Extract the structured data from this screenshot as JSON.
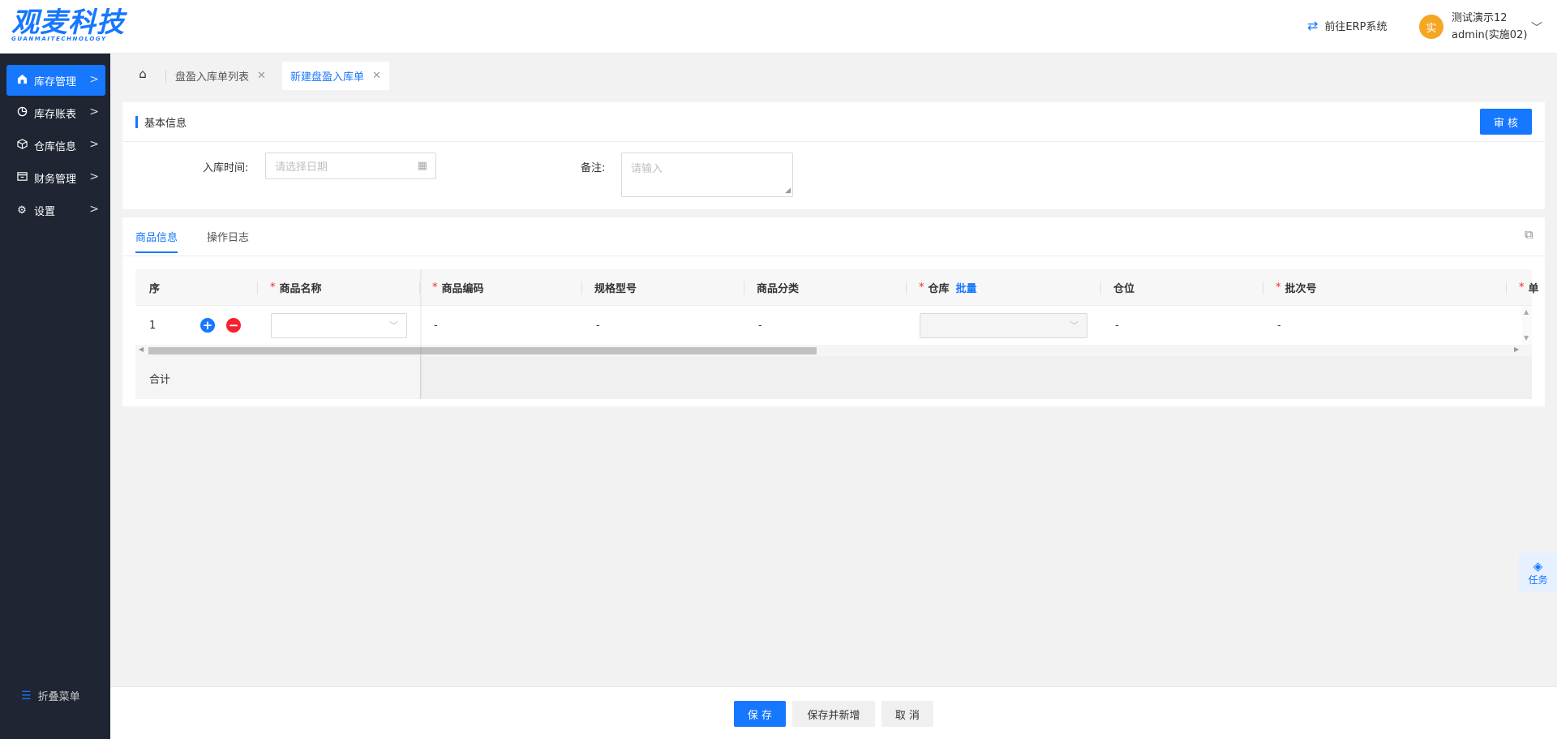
{
  "header": {
    "logo_main": "观麦科技",
    "logo_sub": "GUANMAITECHNOLOGY",
    "erp_link": "前往ERP系统",
    "user_avatar": "实",
    "user_name": "测试演示12",
    "user_account": "admin(实施02)"
  },
  "sidebar": {
    "items": [
      {
        "label": "库存管理",
        "icon": "warehouse-icon",
        "active": true
      },
      {
        "label": "库存账表",
        "icon": "pie-chart-icon",
        "active": false
      },
      {
        "label": "仓库信息",
        "icon": "cube-icon",
        "active": false
      },
      {
        "label": "财务管理",
        "icon": "finance-icon",
        "active": false
      },
      {
        "label": "设置",
        "icon": "gear-icon",
        "active": false
      }
    ],
    "collapse_label": "折叠菜单"
  },
  "tabs": [
    {
      "label": "盘盈入库单列表",
      "active": false
    },
    {
      "label": "新建盘盈入库单",
      "active": true
    }
  ],
  "basic_info": {
    "title": "基本信息",
    "audit_button": "审 核",
    "date_label": "入库时间:",
    "date_placeholder": "请选择日期",
    "remark_label": "备注:",
    "remark_placeholder": "请输入"
  },
  "goods": {
    "tabs": [
      "商品信息",
      "操作日志"
    ],
    "columns": {
      "seq": "序",
      "name": "商品名称",
      "code": "商品编码",
      "spec": "规格型号",
      "category": "商品分类",
      "warehouse": "仓库",
      "bulk": "批量",
      "location": "仓位",
      "batch": "批次号",
      "next": "单"
    },
    "row": {
      "index": "1",
      "code": "-",
      "spec": "-",
      "category": "-",
      "location": "-",
      "batch": "-"
    },
    "total_label": "合计"
  },
  "task_widget": "任务",
  "footer": {
    "save": "保 存",
    "save_new": "保存并新增",
    "cancel": "取 消"
  },
  "colors": {
    "primary": "#1677ff",
    "sidebar_bg": "#1f2533",
    "danger": "#f5222d",
    "avatar": "#f5a623"
  }
}
